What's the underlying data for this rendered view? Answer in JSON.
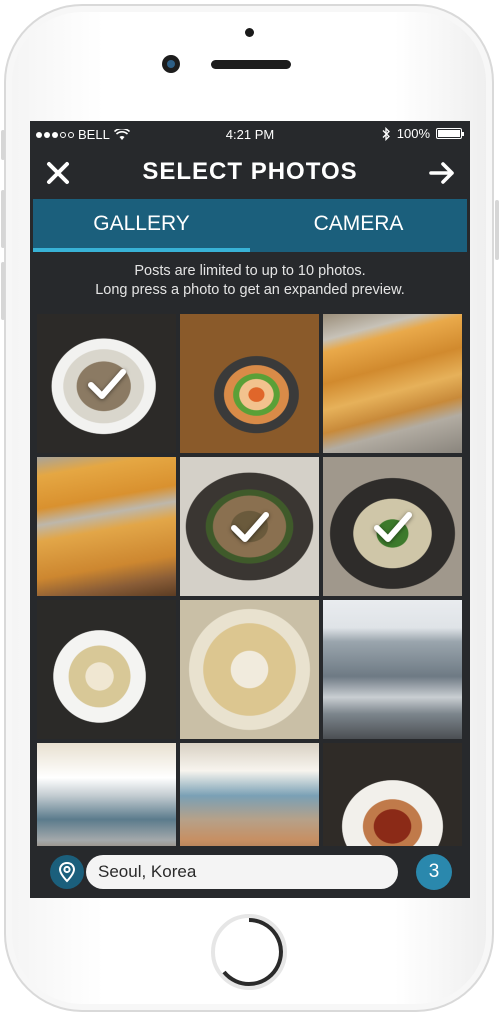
{
  "status_bar": {
    "carrier": "BELL",
    "time": "4:21 PM",
    "battery": "100%"
  },
  "header": {
    "title": "SELECT PHOTOS",
    "close_icon": "close-icon",
    "next_icon": "arrow-right-icon"
  },
  "tabs": [
    {
      "label": "GALLERY",
      "active": true
    },
    {
      "label": "CAMERA",
      "active": false
    }
  ],
  "hint": {
    "line1": "Posts are limited to up to 10 photos.",
    "line2": "Long press a photo to get an expanded preview."
  },
  "photos": [
    {
      "subject": "cold noodles bowl",
      "selected": true
    },
    {
      "subject": "stir-fried dish",
      "selected": false
    },
    {
      "subject": "pancakes on foil",
      "selected": false
    },
    {
      "subject": "pancakes on foil",
      "selected": false
    },
    {
      "subject": "stew pot",
      "selected": true
    },
    {
      "subject": "vegetable stew pot",
      "selected": true
    },
    {
      "subject": "noodle soup",
      "selected": false
    },
    {
      "subject": "noodle soup",
      "selected": false
    },
    {
      "subject": "street with bus",
      "selected": false
    },
    {
      "subject": "fish market stall",
      "selected": false
    },
    {
      "subject": "fish market stall",
      "selected": false
    },
    {
      "subject": "spicy dish plate",
      "selected": false
    }
  ],
  "location": {
    "value": "Seoul, Korea",
    "icon": "location-pin-icon"
  },
  "selected_count": "3",
  "colors": {
    "accent": "#1b5f7c",
    "tab_indicator": "#38b2d6",
    "badge": "#2a88ad",
    "screen_bg": "#27292c"
  }
}
